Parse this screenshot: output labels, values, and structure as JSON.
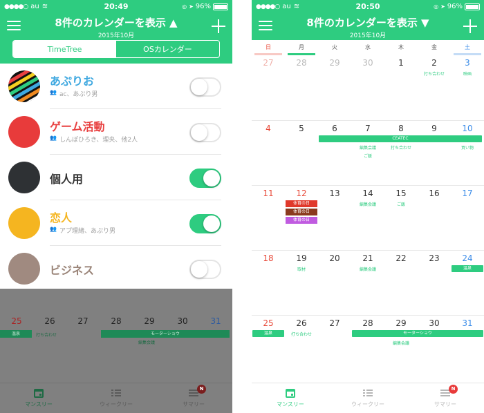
{
  "left": {
    "status": {
      "carrier": "au",
      "time": "20:49",
      "battery": "96%"
    },
    "header": {
      "title": "8件のカレンダーを表示 ▲",
      "subtitle": "2015年10月"
    },
    "segments": [
      {
        "label": "TimeTree",
        "active": true
      },
      {
        "label": "OSカレンダー",
        "active": false
      }
    ],
    "calendars": [
      {
        "name": "あぷりお",
        "members": "ac、あぷり男",
        "color": "#3ea8e0",
        "avatar": "pattern",
        "on": false
      },
      {
        "name": "ゲーム活動",
        "members": "しんぽひろき、理央、他2人",
        "color": "#e84040",
        "avatar": "#e83b3b",
        "on": false
      },
      {
        "name": "個人用",
        "members": "",
        "color": "#333333",
        "avatar": "#2e3134",
        "on": true
      },
      {
        "name": "恋人",
        "members": "アプ理緒、あぷり男",
        "color": "#f5b520",
        "avatar": "#f5b520",
        "on": true
      },
      {
        "name": "ビジネス",
        "members": "",
        "color": "#9a8478",
        "avatar": "#a08a80",
        "on": false
      }
    ],
    "overlay": {
      "days": [
        "25",
        "26",
        "27",
        "28",
        "29",
        "30",
        "31"
      ],
      "events": {
        "onsen": "温泉",
        "meeting": "打ち合わせ",
        "motorshow": "モーターショウ",
        "editing": "編集会議"
      }
    },
    "tabs": [
      {
        "label": "マンスリー"
      },
      {
        "label": "ウィークリー"
      },
      {
        "label": "サマリー",
        "badge": "N"
      }
    ]
  },
  "right": {
    "status": {
      "carrier": "au",
      "time": "20:50",
      "battery": "96%"
    },
    "header": {
      "title": "8件のカレンダーを表示 ▼",
      "subtitle": "2015年10月"
    },
    "weekdays": [
      "日",
      "月",
      "火",
      "水",
      "木",
      "金",
      "土"
    ],
    "weeks": [
      {
        "days": [
          "27",
          "28",
          "29",
          "30",
          "1",
          "2",
          "3"
        ],
        "muted": [
          true,
          true,
          true,
          true,
          false,
          false,
          false
        ]
      },
      {
        "days": [
          "4",
          "5",
          "6",
          "7",
          "8",
          "9",
          "10"
        ],
        "muted": [
          false,
          false,
          false,
          false,
          false,
          false,
          false
        ]
      },
      {
        "days": [
          "11",
          "12",
          "13",
          "14",
          "15",
          "16",
          "17"
        ],
        "muted": [
          false,
          false,
          false,
          false,
          false,
          false,
          false
        ]
      },
      {
        "days": [
          "18",
          "19",
          "20",
          "21",
          "22",
          "23",
          "24"
        ],
        "muted": [
          false,
          false,
          false,
          false,
          false,
          false,
          false
        ]
      },
      {
        "days": [
          "25",
          "26",
          "27",
          "28",
          "29",
          "30",
          "31"
        ],
        "muted": [
          false,
          false,
          false,
          false,
          false,
          false,
          false
        ]
      }
    ],
    "events": {
      "meeting": "打ち合わせ",
      "movie": "映画",
      "ceatec": "CEATEC",
      "editing": "編集会議",
      "gohan": "ご飯",
      "shopping": "買い物",
      "sports_day": "体育の日",
      "interview": "取材",
      "onsen": "温泉",
      "motorshow": "モーターショウ"
    },
    "colors": {
      "sports1": "#e0392b",
      "sports2": "#8b3a1e",
      "sports3": "#c05be0"
    },
    "tabs": [
      {
        "label": "マンスリー"
      },
      {
        "label": "ウィークリー"
      },
      {
        "label": "サマリー",
        "badge": "N"
      }
    ]
  },
  "colors": {
    "brand": "#2ecc80",
    "sunday": "#e84a3a",
    "saturday": "#3b8ce8"
  }
}
